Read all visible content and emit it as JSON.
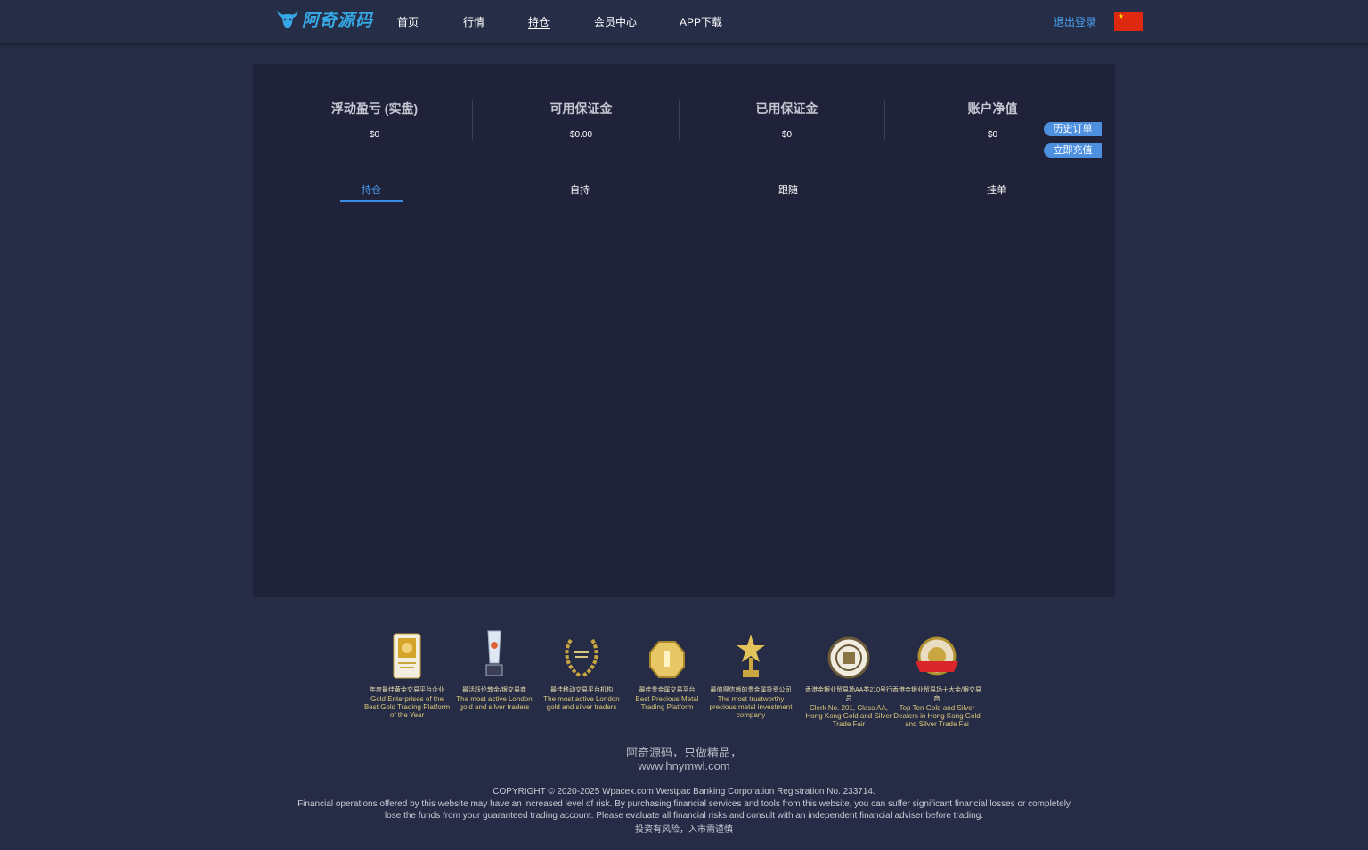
{
  "header": {
    "logo_text": "阿奇源码",
    "nav": [
      "首页",
      "行情",
      "持仓",
      "会员中心",
      "APP下载"
    ],
    "active_nav": "持仓",
    "logout": "退出登录",
    "language_flag": "china-flag-icon"
  },
  "stats": [
    {
      "label": "浮动盈亏 (实盘)",
      "value": "$0"
    },
    {
      "label": "可用保证金",
      "value": "$0.00"
    },
    {
      "label": "已用保证金",
      "value": "$0"
    },
    {
      "label": "账户净值",
      "value": "$0"
    }
  ],
  "side_buttons": {
    "history": "历史订单",
    "deposit": "立即充值"
  },
  "tabs": [
    "持仓",
    "自持",
    "跟随",
    "挂单"
  ],
  "active_tab": "持仓",
  "awards": [
    {
      "cn": "年度最佳黄金交易平台企业",
      "en": "Gold Enterprises of the Best Gold Trading Platform of the Year"
    },
    {
      "cn": "最活跃伦敦金/银交易商",
      "en": "The most active London gold and silver traders"
    },
    {
      "cn": "最佳移动交易平台机构",
      "en": "The most active London gold and silver traders"
    },
    {
      "cn": "最佳贵金属交易平台",
      "en": "Best Precious Metal Trading Platform"
    },
    {
      "cn": "最值得信赖的贵金属投资公司",
      "en": "The most trustworthy precious metal investment company"
    },
    {
      "cn": "香港金银业贸易场AA类210号行员",
      "en": "Clerk No. 201, Class AA, Hong Kong Gold and Silver Trade Fair"
    },
    {
      "cn": "香港金银业贸易场十大金/银交易商",
      "en": "Top Ten Gold and Silver Dealers in Hong Kong Gold and Silver Trade Fai"
    }
  ],
  "footer": {
    "slogan": "阿奇源码，只做精品，",
    "site": "www.hnymwl.com",
    "copyright": "COPYRIGHT © 2020-2025 Wpacex.com Westpac Banking Corporation Registration No. 233714.",
    "disclaimer": "Financial operations offered by this website may have an increased level of risk. By purchasing financial services and tools from this website, you can suffer significant financial losses or completely lose the funds from your guaranteed trading account. Please evaluate all financial risks and consult with an independent financial adviser before trading.",
    "risk": "投资有风险，入市需谨慎"
  },
  "colors": {
    "accent": "#4aa0f0",
    "panel": "#1f2239",
    "background": "#262c45",
    "gold": "#d8c57a"
  }
}
